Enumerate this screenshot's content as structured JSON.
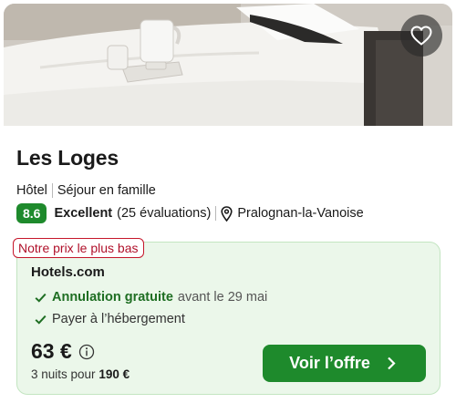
{
  "hotel": {
    "name": "Les Loges",
    "type": "Hôtel",
    "tag": "Séjour en famille",
    "score": "8.6",
    "rating_word": "Excellent",
    "reviews": "(25 évaluations)",
    "location": "Pralognan-la-Vanoise"
  },
  "deal": {
    "badge": "Notre prix le plus bas",
    "provider": "Hotels.com",
    "features": [
      {
        "strong": "Annulation gratuite",
        "extra": "avant le 29 mai"
      },
      {
        "text": "Payer à l’hébergement"
      }
    ],
    "price": "63 €",
    "total_prefix": "3 nuits pour",
    "total_value": "190 €",
    "cta_label": "Voir l’offre"
  },
  "colors": {
    "accent_green": "#1e8a2c",
    "deal_background": "#ebf7ea",
    "badge_red": "#b0102a"
  },
  "icons": [
    "heart-icon",
    "map-pin-icon",
    "check-icon",
    "info-icon",
    "chevron-right-icon"
  ]
}
